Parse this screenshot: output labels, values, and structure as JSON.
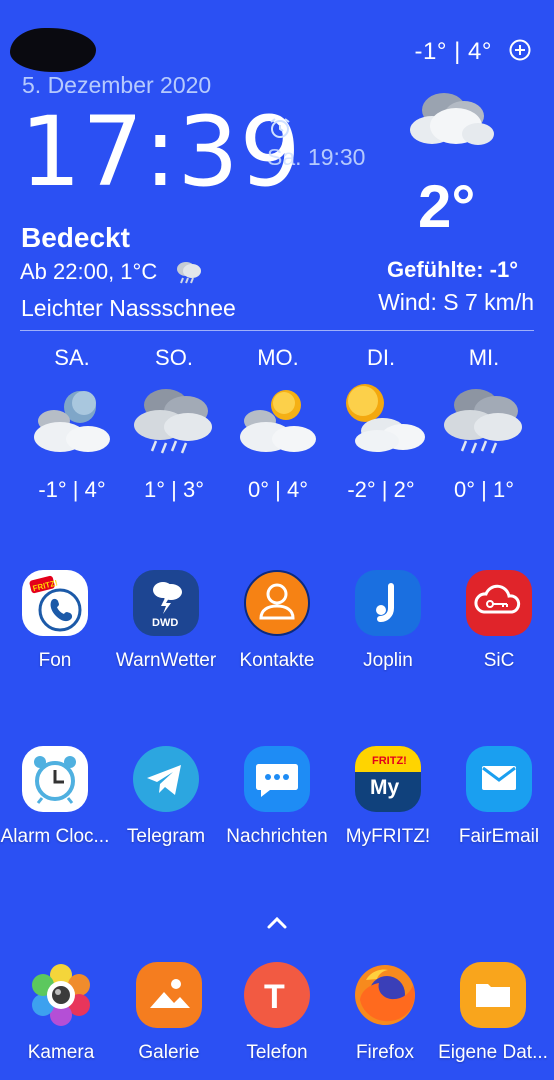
{
  "status": {
    "minmax": "-1° | 4°"
  },
  "widget": {
    "date": "5. Dezember 2020",
    "time": "17:39",
    "alarm": "Sa. 19:30",
    "temperature": "2°",
    "condition": "Bedeckt",
    "next_forecast": "Ab 22:00, 1°C",
    "precipitation": "Leichter Nassschnee",
    "feels_like": "Gefühlte: -1°",
    "wind": "Wind: S 7 km/h"
  },
  "forecast": [
    {
      "day": "SA.",
      "range": "-1° | 4°",
      "icon": "night-cloudy-icon"
    },
    {
      "day": "SO.",
      "range": "1° | 3°",
      "icon": "rain-cloud-icon"
    },
    {
      "day": "MO.",
      "range": "0° | 4°",
      "icon": "partly-sunny-icon"
    },
    {
      "day": "DI.",
      "range": "-2° | 2°",
      "icon": "sun-cloud-icon"
    },
    {
      "day": "MI.",
      "range": "0° | 1°",
      "icon": "rain-cloud-icon"
    }
  ],
  "apps_row1": [
    {
      "label": "Fon",
      "icon": "fritz-fon-icon"
    },
    {
      "label": "WarnWetter",
      "icon": "dwd-warnwetter-icon"
    },
    {
      "label": "Kontakte",
      "icon": "contacts-icon"
    },
    {
      "label": "Joplin",
      "icon": "joplin-icon"
    },
    {
      "label": "SiC",
      "icon": "sic-cloud-key-icon"
    }
  ],
  "apps_row2": [
    {
      "label": "Alarm Cloc...",
      "icon": "alarm-clock-icon"
    },
    {
      "label": "Telegram",
      "icon": "telegram-icon"
    },
    {
      "label": "Nachrichten",
      "icon": "messages-icon"
    },
    {
      "label": "MyFRITZ!",
      "icon": "myfritz-icon"
    },
    {
      "label": "FairEmail",
      "icon": "email-icon"
    }
  ],
  "dock": [
    {
      "label": "Kamera",
      "icon": "camera-icon"
    },
    {
      "label": "Galerie",
      "icon": "gallery-icon"
    },
    {
      "label": "Telefon",
      "icon": "phone-icon"
    },
    {
      "label": "Firefox",
      "icon": "firefox-icon"
    },
    {
      "label": "Eigene Dat...",
      "icon": "folder-icon"
    }
  ],
  "icon_labels": {
    "dwd": "DWD",
    "fritz": "FRITZ!",
    "my": "My",
    "telefon": "T"
  },
  "colors": {
    "background": "#2b50f3",
    "divider": "#ffffff"
  }
}
